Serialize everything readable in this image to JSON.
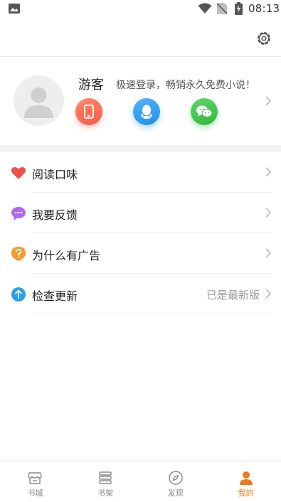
{
  "status_bar": {
    "time": "08:13",
    "icons": [
      "gallery-icon",
      "wifi-icon",
      "no-sim-icon",
      "battery-charging-icon"
    ]
  },
  "top_bar": {
    "settings_icon": "gear-icon"
  },
  "profile": {
    "username": "游客",
    "promo_text": "极速登录，畅销永久免费小说！",
    "login_options": [
      {
        "name": "phone",
        "icon": "phone-icon",
        "color": "#f25a48"
      },
      {
        "name": "qq",
        "icon": "qq-penguin-icon",
        "color": "#1f8ee8"
      },
      {
        "name": "wechat",
        "icon": "wechat-icon",
        "color": "#2fb53c"
      }
    ]
  },
  "menu": {
    "items": [
      {
        "label": "阅读口味",
        "icon": "heart-icon",
        "value": ""
      },
      {
        "label": "我要反馈",
        "icon": "chat-bubble-icon",
        "value": ""
      },
      {
        "label": "为什么有广告",
        "icon": "question-icon",
        "value": ""
      },
      {
        "label": "检查更新",
        "icon": "upload-arrow-icon",
        "value": "已是最新版"
      }
    ]
  },
  "tab_bar": {
    "tabs": [
      {
        "label": "书城",
        "icon": "bookstore-icon",
        "active": false
      },
      {
        "label": "书架",
        "icon": "bookshelf-icon",
        "active": false
      },
      {
        "label": "发现",
        "icon": "compass-icon",
        "active": false
      },
      {
        "label": "我的",
        "icon": "person-icon",
        "active": true
      }
    ],
    "active_color": "#ee7a1c",
    "inactive_color": "#888888"
  }
}
